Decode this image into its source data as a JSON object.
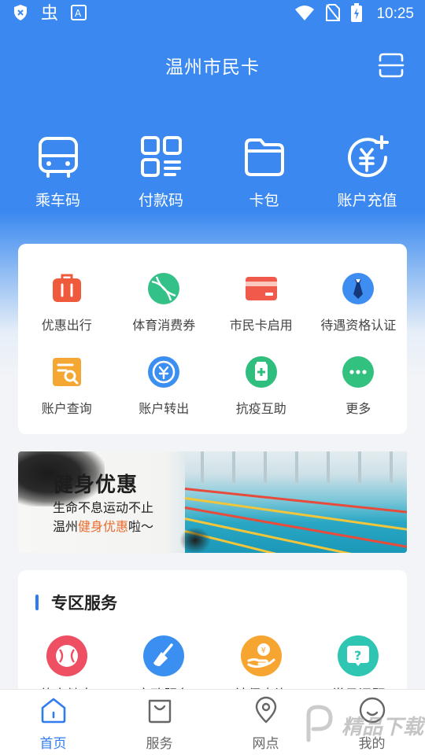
{
  "status_bar": {
    "time": "10:25"
  },
  "header": {
    "title": "温州市民卡"
  },
  "quick_actions": [
    {
      "label": "乘车码",
      "icon": "bus-icon"
    },
    {
      "label": "付款码",
      "icon": "qr-code-icon"
    },
    {
      "label": "卡包",
      "icon": "folder-icon"
    },
    {
      "label": "账户充值",
      "icon": "yuan-add-icon"
    }
  ],
  "services_grid": [
    {
      "label": "优惠出行",
      "icon": "luggage-icon",
      "color": "#ef5a3c"
    },
    {
      "label": "体育消费券",
      "icon": "tennis-ball-icon",
      "color": "#33c187"
    },
    {
      "label": "市民卡启用",
      "icon": "card-icon",
      "color": "#f05a4a"
    },
    {
      "label": "待遇资格认证",
      "icon": "tie-icon",
      "color": "#3e8ef2"
    },
    {
      "label": "账户查询",
      "icon": "search-document-icon",
      "color": "#f4a732"
    },
    {
      "label": "账户转出",
      "icon": "yuan-transfer-icon",
      "color": "#3b8ff0"
    },
    {
      "label": "抗疫互助",
      "icon": "medicine-icon",
      "color": "#2fbe7d"
    },
    {
      "label": "更多",
      "icon": "more-icon",
      "color": "#33c17f"
    }
  ],
  "banner": {
    "title": "健身优惠",
    "line1": "生命不息运动不止",
    "line2_prefix": "温州",
    "line2_highlight": "健身优惠",
    "line2_suffix": "啦～"
  },
  "zone": {
    "title": "专区服务",
    "items": [
      {
        "label": "体育健身",
        "icon": "baseball-icon",
        "color": "#ef4f62"
      },
      {
        "label": "家政服务",
        "icon": "broom-icon",
        "color": "#3b8ff0"
      },
      {
        "label": "社保查询",
        "icon": "hand-coin-icon",
        "color": "#f7a531"
      },
      {
        "label": "常见问题",
        "icon": "question-icon",
        "color": "#2ec6b2"
      }
    ]
  },
  "tab_bar": [
    {
      "label": "首页",
      "icon": "home-icon",
      "active": true
    },
    {
      "label": "服务",
      "icon": "bag-icon",
      "active": false
    },
    {
      "label": "网点",
      "icon": "location-icon",
      "active": false
    },
    {
      "label": "我的",
      "icon": "smile-icon",
      "active": false
    }
  ],
  "watermark": {
    "text": "精品下载"
  },
  "colors": {
    "brand_blue": "#3a88f0",
    "active_tab": "#2f7cf0"
  }
}
